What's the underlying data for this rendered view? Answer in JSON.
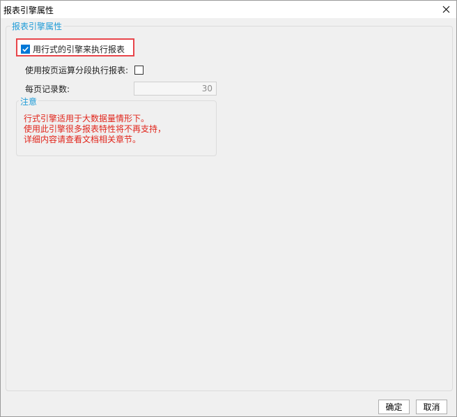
{
  "window": {
    "title": "报表引擎属性",
    "close_icon": "close-icon"
  },
  "group": {
    "legend": "报表引擎属性",
    "row_engine": {
      "label": "用行式的引擎来执行报表",
      "checked": true
    },
    "paging": {
      "label": "使用按页运算分段执行报表:",
      "checked": false
    },
    "records_per_page": {
      "label": "每页记录数:",
      "value": "30"
    }
  },
  "notice": {
    "legend": "注意",
    "lines": [
      "行式引擎适用于大数据量情形下。",
      "使用此引擎很多报表特性将不再支持，",
      "详细内容请查看文档相关章节。"
    ]
  },
  "footer": {
    "ok_label": "确定",
    "cancel_label": "取消"
  },
  "colors": {
    "accent": "#1e9bd7",
    "highlight_border": "#e8454a",
    "warning_text": "#e1251b",
    "checkbox_checked": "#0078d7"
  }
}
